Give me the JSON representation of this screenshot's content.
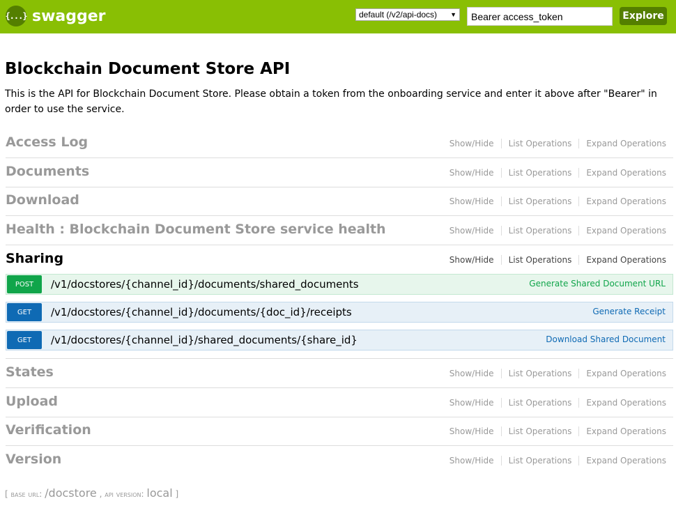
{
  "header": {
    "logo_glyph": "{...}",
    "logo_text": "swagger",
    "spec_select": "default (/v2/api-docs)",
    "api_key_value": "Bearer access_token",
    "explore_label": "Explore",
    "colors": {
      "bar": "#89bf04",
      "accent": "#547f00"
    }
  },
  "info": {
    "title": "Blockchain Document Store API",
    "description": "This is the API for Blockchain Document Store. Please obtain a token from the onboarding service and enter it above after \"Bearer\" in order to use the service."
  },
  "resource_links": {
    "show_hide": "Show/Hide",
    "list_operations": "List Operations",
    "expand_operations": "Expand Operations"
  },
  "resources": [
    {
      "name": "Access Log"
    },
    {
      "name": "Documents"
    },
    {
      "name": "Download"
    },
    {
      "name": "Health : Blockchain Document Store service health"
    },
    {
      "name": "Sharing"
    },
    {
      "name": "States"
    },
    {
      "name": "Upload"
    },
    {
      "name": "Verification"
    },
    {
      "name": "Version"
    }
  ],
  "operations": [
    {
      "method": "POST",
      "path": "/v1/docstores/{channel_id}/documents/shared_documents",
      "summary": "Generate Shared Document URL"
    },
    {
      "method": "GET",
      "path": "/v1/docstores/{channel_id}/documents/{doc_id}/receipts",
      "summary": "Generate Receipt"
    },
    {
      "method": "GET",
      "path": "/v1/docstores/{channel_id}/shared_documents/{share_id}",
      "summary": "Download Shared Document"
    }
  ],
  "footer": {
    "open_bracket": "[",
    "base_url_label": "base url",
    "base_url_value": "/docstore",
    "separator": ",",
    "api_version_label": "api version",
    "api_version_value": "local",
    "close_bracket": "]"
  }
}
